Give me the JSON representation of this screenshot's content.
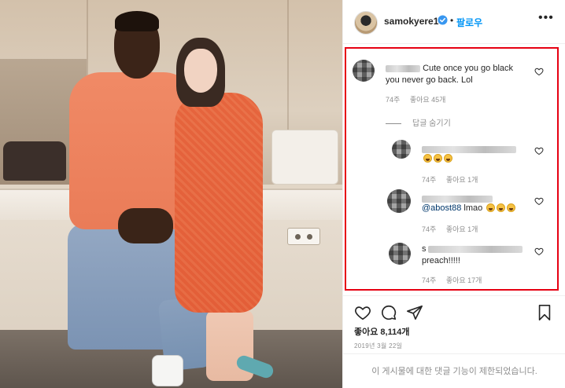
{
  "post": {
    "username": "samokyere1",
    "separator": "•",
    "follow_label": "팔로우",
    "more_label": "•••"
  },
  "comments": [
    {
      "text": "Cute once you go black you never go back. Lol",
      "time": "74주",
      "likes": "좋아요 45개",
      "hide_replies": "답글 숨기기"
    }
  ],
  "replies": [
    {
      "time": "74주",
      "likes": "좋아요 1개",
      "emoji": [
        "rofl-emoji",
        "rofl-emoji",
        "rofl-emoji"
      ]
    },
    {
      "mention": "@abost88",
      "text": " lmao",
      "time": "74주",
      "likes": "좋아요 1개",
      "emoji": [
        "joy-emoji",
        "joy-emoji",
        "joy-emoji"
      ]
    },
    {
      "text": "preach!!!!!",
      "prefix": "s",
      "time": "74주",
      "likes": "좋아요 17개"
    }
  ],
  "footer": {
    "likes": "좋아요 8,114개",
    "date": "2019년 3월 22일",
    "comments_restricted": "이 게시물에 대한 댓글 기능이 제한되었습니다."
  },
  "icons": {
    "verified": "verified-badge-icon",
    "heart": "heart-icon",
    "comment": "comment-icon",
    "share": "paper-plane-icon",
    "save": "bookmark-icon"
  },
  "colors": {
    "accent_blue": "#0095f6",
    "highlight_red": "#e60012",
    "muted": "#8e8e8e"
  }
}
